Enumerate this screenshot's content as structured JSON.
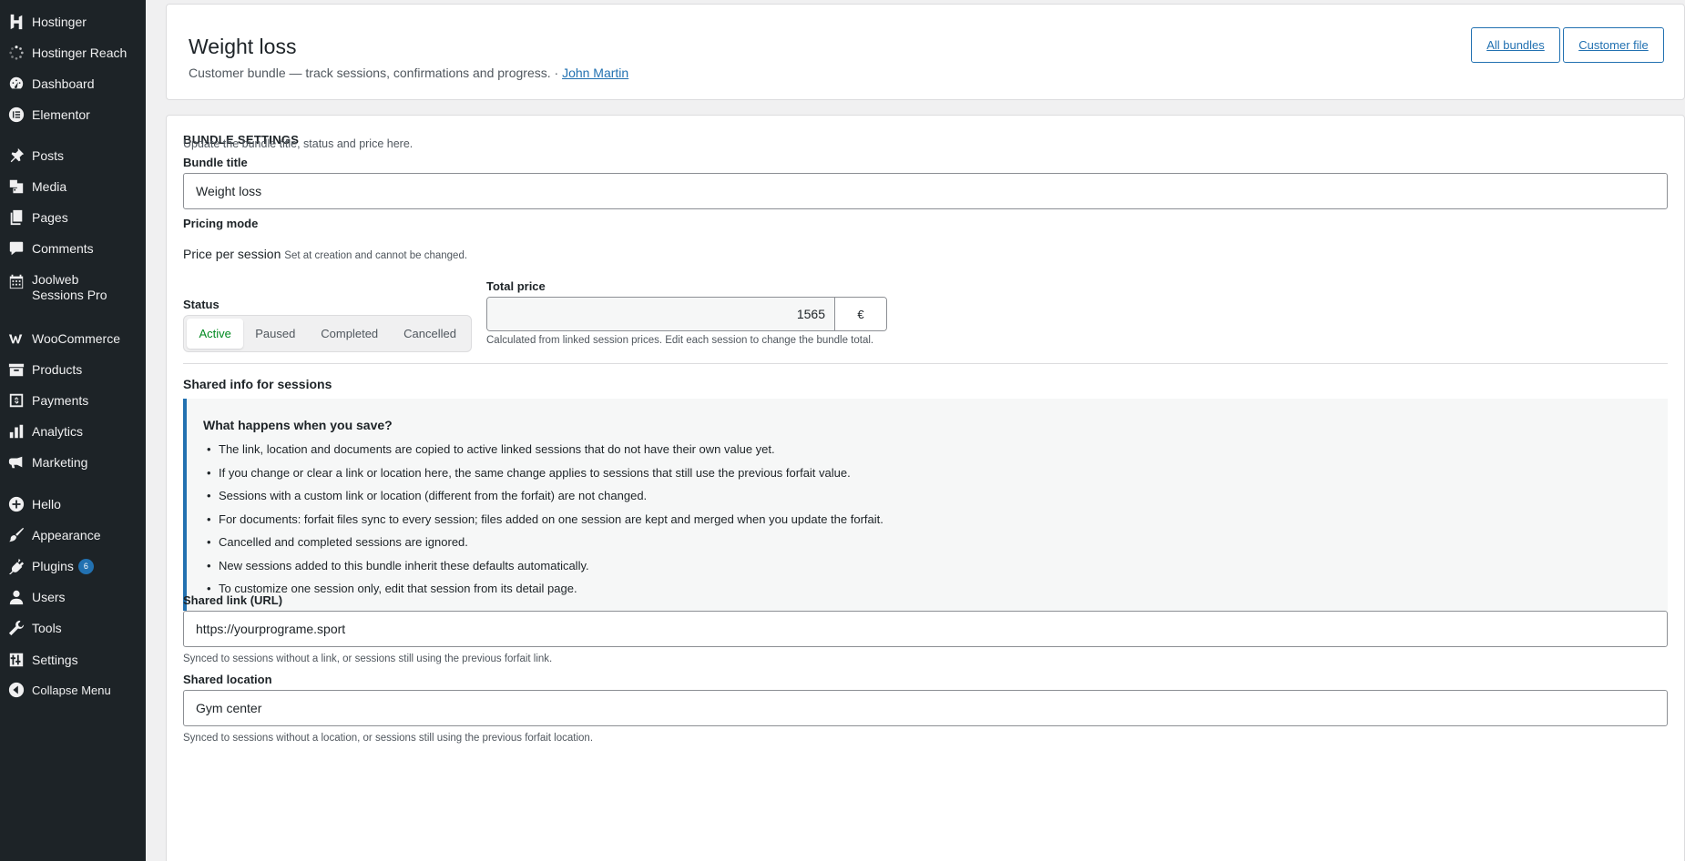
{
  "sidebar": {
    "items": [
      {
        "label": "Hostinger",
        "icon": "hostinger-icon"
      },
      {
        "label": "Hostinger Reach",
        "icon": "spinner-icon"
      },
      {
        "label": "Dashboard",
        "icon": "dashboard-icon"
      },
      {
        "label": "Elementor",
        "icon": "elementor-icon"
      },
      {
        "label": "Posts",
        "icon": "pin-icon"
      },
      {
        "label": "Media",
        "icon": "media-icon"
      },
      {
        "label": "Pages",
        "icon": "pages-icon"
      },
      {
        "label": "Comments",
        "icon": "comment-icon"
      },
      {
        "label": "Joolweb Sessions Pro",
        "icon": "calendar-icon"
      },
      {
        "label": "WooCommerce",
        "icon": "woo-icon"
      },
      {
        "label": "Products",
        "icon": "archive-icon"
      },
      {
        "label": "Payments",
        "icon": "payments-icon"
      },
      {
        "label": "Analytics",
        "icon": "chart-bar-icon"
      },
      {
        "label": "Marketing",
        "icon": "megaphone-icon"
      },
      {
        "label": "Hello",
        "icon": "plus-circle-icon"
      },
      {
        "label": "Appearance",
        "icon": "brush-icon"
      },
      {
        "label": "Plugins",
        "icon": "plug-icon",
        "badge": "6"
      },
      {
        "label": "Users",
        "icon": "user-icon"
      },
      {
        "label": "Tools",
        "icon": "wrench-icon"
      },
      {
        "label": "Settings",
        "icon": "settings-icon"
      },
      {
        "label": "Collapse Menu",
        "icon": "collapse-icon"
      }
    ]
  },
  "header": {
    "title": "Weight loss",
    "subtitle": "Customer bundle — track sessions, confirmations and progress. ·",
    "customer_link": "John Martin",
    "btn_all_bundles": "All bundles",
    "btn_customer_file": "Customer file"
  },
  "settings": {
    "section_title": "BUNDLE SETTINGS",
    "help": "Update the bundle title, status and price here.",
    "bundle_title_label": "Bundle title",
    "bundle_title_value": "Weight loss",
    "pricing_mode_label": "Pricing mode",
    "pricing_mode_value": "Price per session",
    "pricing_mode_note": "Set at creation and cannot be changed.",
    "status_label": "Status",
    "status_options": [
      "Active",
      "Paused",
      "Completed",
      "Cancelled"
    ],
    "status_selected": "Active",
    "total_price_label": "Total price",
    "total_price_value": "1565",
    "currency": "€",
    "total_price_help": "Calculated from linked session prices. Edit each session to change the bundle total.",
    "shared_heading": "Shared info for sessions",
    "info_title": "What happens when you save?",
    "info_items": [
      "The link, location and documents are copied to active linked sessions that do not have their own value yet.",
      "If you change or clear a link or location here, the same change applies to sessions that still use the previous forfait value.",
      "Sessions with a custom link or location (different from the forfait) are not changed.",
      "For documents: forfait files sync to every session; files added on one session are kept and merged when you update the forfait.",
      "Cancelled and completed sessions are ignored.",
      "New sessions added to this bundle inherit these defaults automatically.",
      "To customize one session only, edit that session from its detail page."
    ],
    "shared_link_label": "Shared link (URL)",
    "shared_link_value": "https://yourprograme.sport",
    "shared_link_help": "Synced to sessions without a link, or sessions still using the previous forfait link.",
    "shared_location_label": "Shared location",
    "shared_location_value": "Gym center",
    "shared_location_help": "Synced to sessions without a location, or sessions still using the previous forfait location."
  },
  "colors": {
    "sidebar_bg": "#1d2327",
    "accent": "#2271b1",
    "active_status": "#008a20"
  }
}
